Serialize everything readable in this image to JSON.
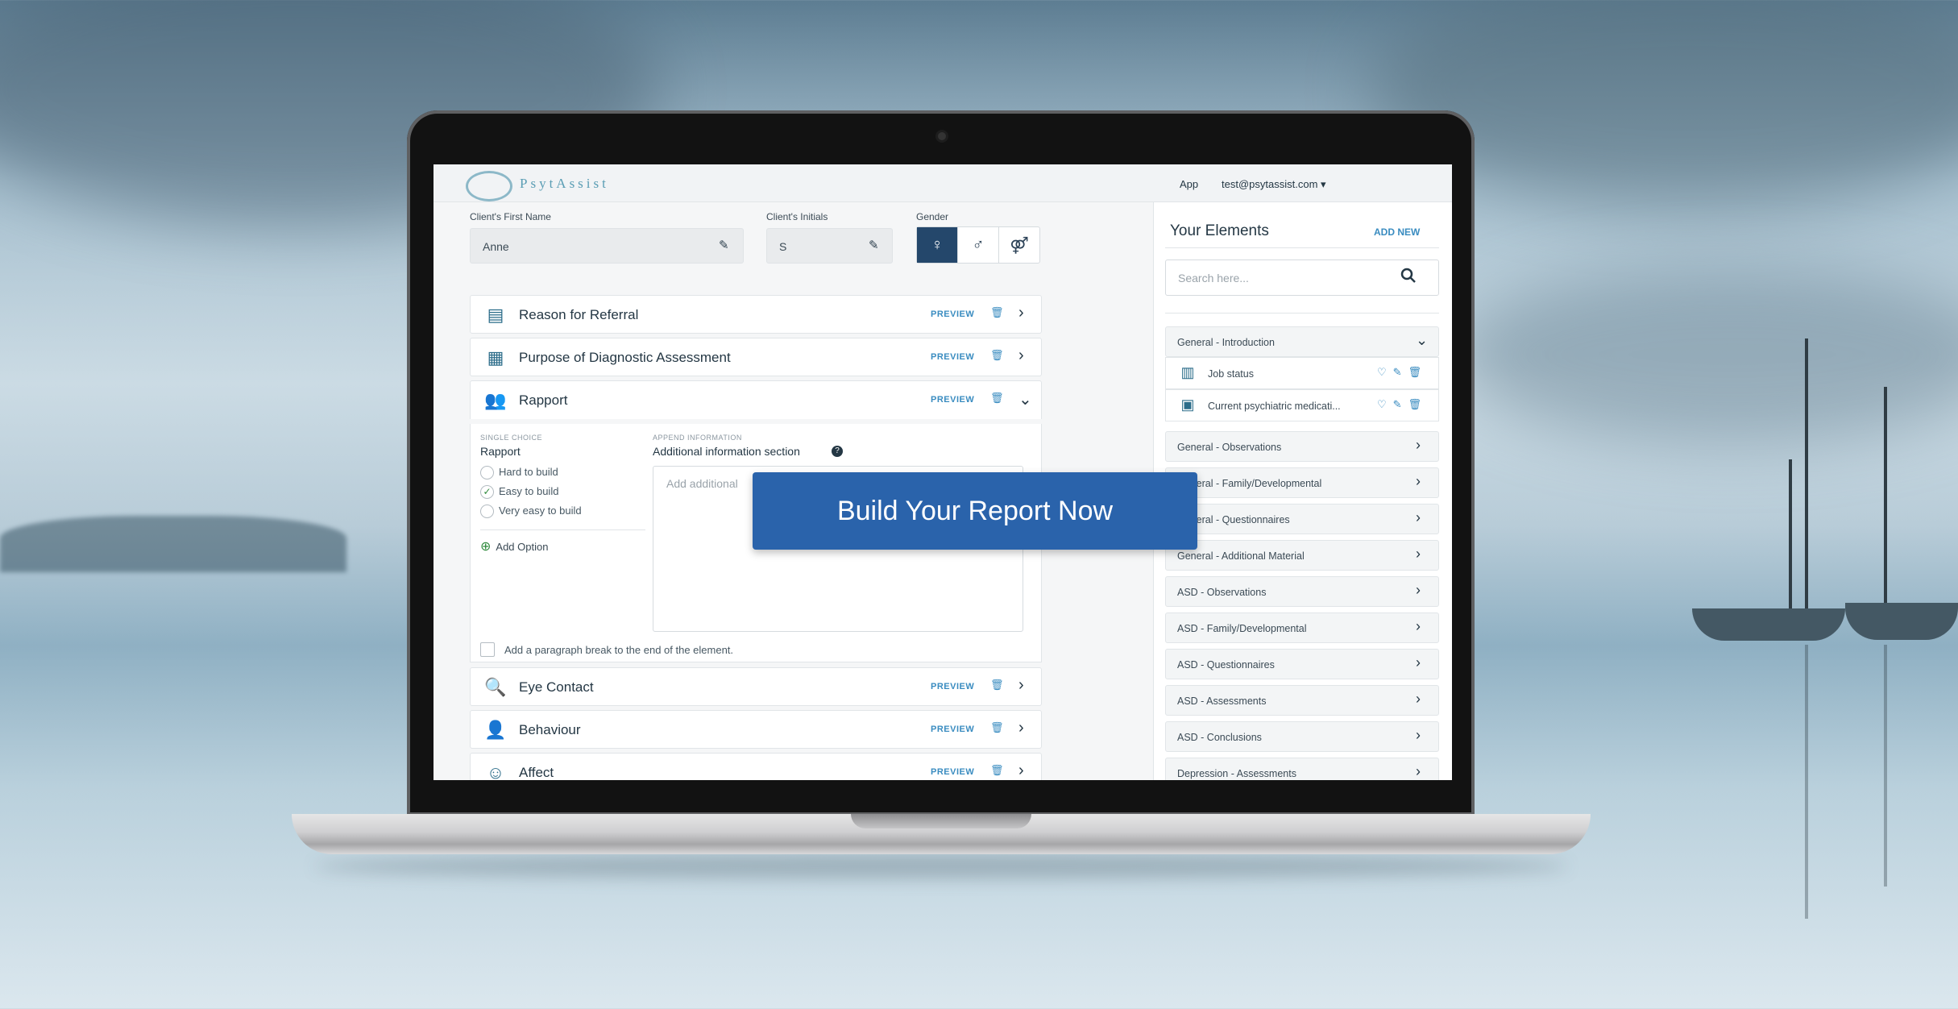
{
  "header": {
    "logo_text": "PsytAssist",
    "nav_app": "App",
    "user_email": "test@psytassist.com ▾"
  },
  "client": {
    "first_name_label": "Client's First Name",
    "first_name_value": "Anne",
    "initials_label": "Client's Initials",
    "initials_value": "S",
    "gender_label": "Gender",
    "gender_icons": [
      "female-icon",
      "male-icon",
      "couple-icon"
    ]
  },
  "report_elements": [
    {
      "title": "Reason for Referral",
      "preview": "PREVIEW",
      "icon": "id-card-icon"
    },
    {
      "title": "Purpose of Diagnostic Assessment",
      "preview": "PREVIEW",
      "icon": "calendar-icon"
    },
    {
      "title": "Rapport",
      "preview": "PREVIEW",
      "icon": "people-icon"
    },
    {
      "title": "Eye Contact",
      "preview": "PREVIEW",
      "icon": "eye-magnifier-icon"
    },
    {
      "title": "Behaviour",
      "preview": "PREVIEW",
      "icon": "person-icon"
    },
    {
      "title": "Affect",
      "preview": "PREVIEW",
      "icon": "smiley-icon"
    }
  ],
  "rapport_detail": {
    "choice_type": "SINGLE CHOICE",
    "question": "Rapport",
    "options": [
      "Hard to build",
      "Easy to build",
      "Very easy to build"
    ],
    "selected_option": "Easy to build",
    "add_option": "Add Option",
    "append_label": "APPEND INFORMATION",
    "additional_title": "Additional information section",
    "textarea_placeholder": "Add additional",
    "paragraph_break_label": "Add a paragraph break to the end of the element."
  },
  "panel": {
    "title": "Your Elements",
    "add_new": "ADD NEW",
    "search_placeholder": "Search here...",
    "categories": [
      "General - Introduction",
      "General - Observations",
      "General - Family/Developmental",
      "General - Questionnaires",
      "General - Additional Material",
      "ASD - Observations",
      "ASD - Family/Developmental",
      "ASD - Questionnaires",
      "ASD - Assessments",
      "ASD - Conclusions",
      "Depression - Assessments"
    ],
    "intro_items": [
      {
        "label": "Job status",
        "icon": "books-icon"
      },
      {
        "label": "Current psychiatric medicati...",
        "icon": "locked-folder-icon"
      }
    ]
  },
  "cta": {
    "label": "Build Your Report Now"
  },
  "colors": {
    "accent": "#2a63ab",
    "preview": "#3a8cc0",
    "gender_active": "#24476b"
  }
}
